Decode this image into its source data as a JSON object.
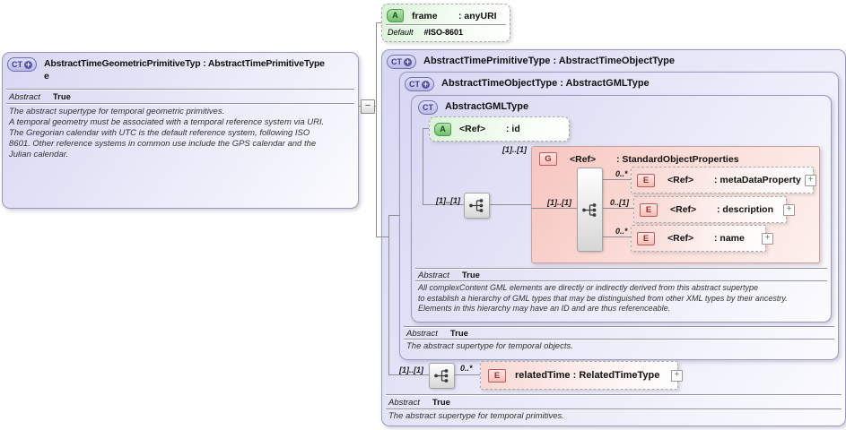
{
  "icons": {
    "complex_type": "CT",
    "attribute": "A",
    "group": "G",
    "element": "E",
    "derived_plus": "+",
    "expand": "+",
    "collapse": "−"
  },
  "left_box": {
    "title_line1": "AbstractTimeGeometricPrimitiveTyp : AbstractTimePrimitiveType",
    "title_line2": "e",
    "abstract_label": "Abstract",
    "abstract_value": "True",
    "doc": "The abstract supertype for temporal geometric primitives.\nA temporal geometry must be associated with a temporal reference system via URI.\nThe Gregorian calendar with UTC is the default reference system, following ISO\n8601. Other reference systems in common use include the GPS calendar and the\nJulian calendar."
  },
  "frame_attribute": {
    "name": "frame",
    "type": ": anyURI",
    "default_label": "Default",
    "default_value": "#ISO-8601"
  },
  "time_primitive": {
    "title": "AbstractTimePrimitiveType : AbstractTimeObjectType",
    "abstract_label": "Abstract",
    "abstract_value": "True",
    "doc": "The abstract supertype for temporal primitives.",
    "sequence_cardinality": "[1]..[1]",
    "related_time": {
      "cardinality": "0..*",
      "label": "relatedTime : RelatedTimeType"
    }
  },
  "time_object": {
    "title": "AbstractTimeObjectType : AbstractGMLType",
    "abstract_label": "Abstract",
    "abstract_value": "True",
    "doc": "The abstract supertype for temporal objects."
  },
  "gml_type": {
    "title": "AbstractGMLType",
    "id_attribute": {
      "ref": "<Ref>",
      "type": ": id"
    },
    "group_cardinality": "[1]..[1]",
    "sequence_cardinality": "[1]..[1]",
    "abstract_label": "Abstract",
    "abstract_value": "True",
    "doc": "All complexContent GML elements are directly or indirectly derived from this abstract supertype\nto establish a hierarchy of GML types that may be distinguished from other XML types by their ancestry.\nElements in this hierarchy may have an ID and are thus referenceable."
  },
  "group": {
    "ref": "<Ref>",
    "name": ": StandardObjectProperties",
    "sequence_cardinality": "[1]..[1]",
    "elements": [
      {
        "cardinality": "0..*",
        "ref": "<Ref>",
        "name": ": metaDataProperty"
      },
      {
        "cardinality": "0..[1]",
        "ref": "<Ref>",
        "name": ": description"
      },
      {
        "cardinality": "0..*",
        "ref": "<Ref>",
        "name": ": name"
      }
    ]
  }
}
